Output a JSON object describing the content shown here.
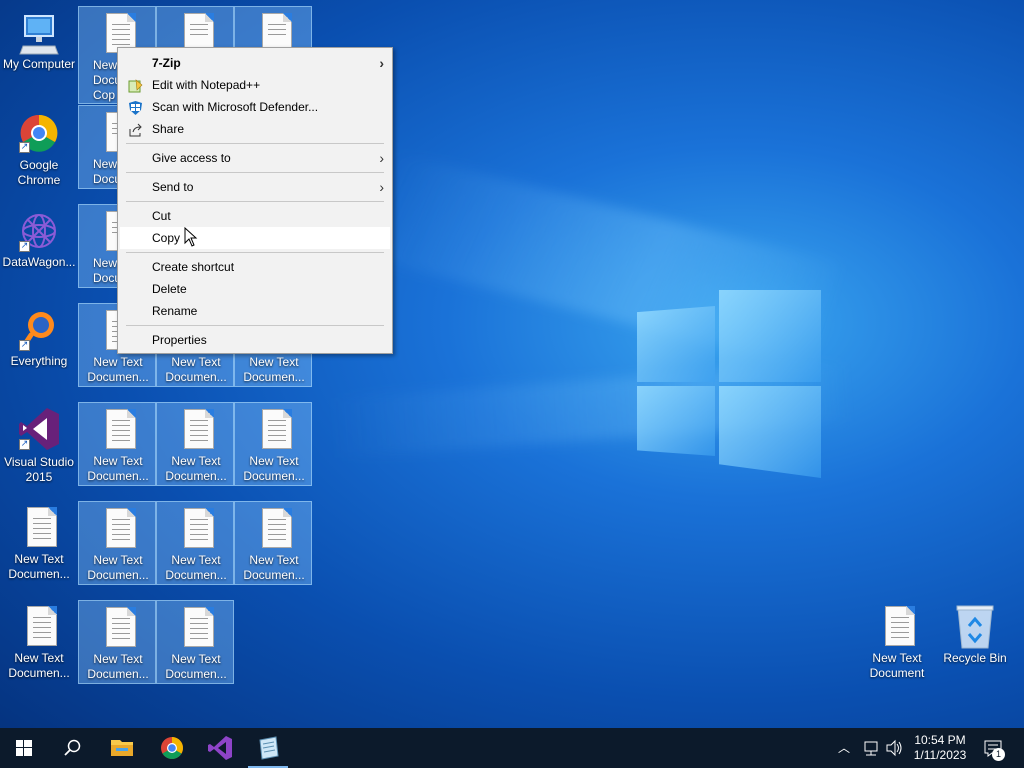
{
  "desktop": {
    "icons_left": [
      {
        "label": "My Computer",
        "icon": "computer-icon"
      },
      {
        "label": "Google Chrome",
        "icon": "chrome-icon"
      },
      {
        "label": "DataWagon...",
        "icon": "datawagon-icon"
      },
      {
        "label": "Everything",
        "icon": "everything-icon"
      },
      {
        "label": "Visual Studio 2015",
        "icon": "visual-studio-icon"
      },
      {
        "label": "New Text Documen...",
        "icon": "text-document-icon"
      },
      {
        "label": "New Text Documen...",
        "icon": "text-document-icon"
      }
    ],
    "selected_docs": {
      "row1_first_label": "New Text Document - Copy",
      "row1_first_partial": [
        "New",
        "Docu",
        "Cop"
      ],
      "row2_first_partial": [
        "New",
        "Docu"
      ],
      "row3_first_partial": [
        "New",
        "Docu"
      ],
      "generic_label": "New Text Documen..."
    },
    "icons_right": [
      {
        "label": "New Text Document",
        "icon": "text-document-icon"
      },
      {
        "label": "Recycle Bin",
        "icon": "recycle-bin-icon"
      }
    ]
  },
  "context_menu": {
    "items": [
      {
        "label": "7-Zip",
        "submenu": true,
        "bold": true
      },
      {
        "label": "Edit with Notepad++",
        "icon": "notepad-plus-icon"
      },
      {
        "label": "Scan with Microsoft Defender...",
        "icon": "defender-icon"
      },
      {
        "label": "Share",
        "icon": "share-icon"
      },
      {
        "label": "Give access to",
        "submenu": true
      },
      {
        "label": "Send to",
        "submenu": true
      },
      {
        "label": "Cut"
      },
      {
        "label": "Copy",
        "hovered": true
      },
      {
        "label": "Create shortcut"
      },
      {
        "label": "Delete"
      },
      {
        "label": "Rename"
      },
      {
        "label": "Properties"
      }
    ]
  },
  "taskbar": {
    "clock_time": "10:54 PM",
    "clock_date": "1/11/2023",
    "notification_count": "1",
    "pinned": [
      "start-icon",
      "search-icon",
      "file-explorer-icon",
      "chrome-icon",
      "visual-studio-icon",
      "notepad-icon"
    ]
  },
  "colors": {
    "desktop_accent": "#1a72d8",
    "taskbar_bg": "#0c1a2b",
    "selection": "#8cc8ff",
    "menu_bg": "#f2f2f2"
  }
}
